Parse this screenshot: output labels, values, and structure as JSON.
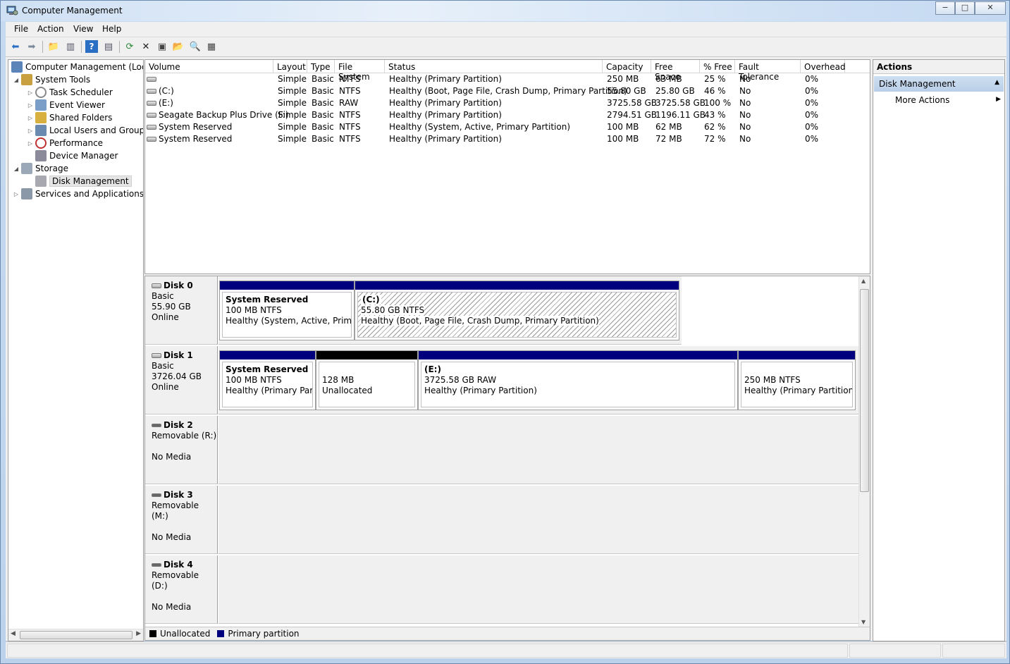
{
  "window": {
    "title": "Computer Management",
    "min": "−",
    "max": "□",
    "close": "✕"
  },
  "menu": [
    "File",
    "Action",
    "View",
    "Help"
  ],
  "tree": {
    "root": "Computer Management (Local",
    "system_tools": "System Tools",
    "task_scheduler": "Task Scheduler",
    "event_viewer": "Event Viewer",
    "shared_folders": "Shared Folders",
    "local_users": "Local Users and Groups",
    "performance": "Performance",
    "device_manager": "Device Manager",
    "storage": "Storage",
    "disk_management": "Disk Management",
    "services": "Services and Applications"
  },
  "volumes": {
    "headers": [
      "Volume",
      "Layout",
      "Type",
      "File System",
      "Status",
      "Capacity",
      "Free Space",
      "% Free",
      "Fault Tolerance",
      "Overhead"
    ],
    "rows": [
      [
        "",
        "Simple",
        "Basic",
        "NTFS",
        "Healthy (Primary Partition)",
        "250 MB",
        "63 MB",
        "25 %",
        "No",
        "0%"
      ],
      [
        "(C:)",
        "Simple",
        "Basic",
        "NTFS",
        "Healthy (Boot, Page File, Crash Dump, Primary Partition)",
        "55.80 GB",
        "25.80 GB",
        "46 %",
        "No",
        "0%"
      ],
      [
        "(E:)",
        "Simple",
        "Basic",
        "RAW",
        "Healthy (Primary Partition)",
        "3725.58 GB",
        "3725.58 GB",
        "100 %",
        "No",
        "0%"
      ],
      [
        "Seagate Backup Plus Drive (F:)",
        "Simple",
        "Basic",
        "NTFS",
        "Healthy (Primary Partition)",
        "2794.51 GB",
        "1196.11 GB",
        "43 %",
        "No",
        "0%"
      ],
      [
        "System Reserved",
        "Simple",
        "Basic",
        "NTFS",
        "Healthy (System, Active, Primary Partition)",
        "100 MB",
        "62 MB",
        "62 %",
        "No",
        "0%"
      ],
      [
        "System Reserved",
        "Simple",
        "Basic",
        "NTFS",
        "Healthy (Primary Partition)",
        "100 MB",
        "72 MB",
        "72 %",
        "No",
        "0%"
      ]
    ]
  },
  "disks": [
    {
      "name": "Disk 0",
      "type": "Basic",
      "size": "55.90 GB",
      "state": "Online",
      "partitions": [
        {
          "title": "System Reserved",
          "size": "100 MB NTFS",
          "status": "Healthy (System, Active, Primary P"
        },
        {
          "title": "(C:)",
          "size": "55.80 GB NTFS",
          "status": "Healthy (Boot, Page File, Crash Dump, Primary Partition)"
        }
      ]
    },
    {
      "name": "Disk 1",
      "type": "Basic",
      "size": "3726.04 GB",
      "state": "Online",
      "partitions": [
        {
          "title": "System Reserved",
          "size": "100 MB NTFS",
          "status": "Healthy (Primary Partition)"
        },
        {
          "title": "",
          "size": "128 MB",
          "status": "Unallocated"
        },
        {
          "title": "(E:)",
          "size": "3725.58 GB RAW",
          "status": "Healthy (Primary Partition)"
        },
        {
          "title": "",
          "size": "250 MB NTFS",
          "status": "Healthy (Primary Partition)"
        }
      ]
    },
    {
      "name": "Disk 2",
      "type": "Removable (R:)",
      "state": "No Media"
    },
    {
      "name": "Disk 3",
      "type": "Removable (M:)",
      "state": "No Media"
    },
    {
      "name": "Disk 4",
      "type": "Removable (D:)",
      "state": "No Media"
    }
  ],
  "legend": {
    "unallocated": "Unallocated",
    "primary": "Primary partition"
  },
  "actions": {
    "title": "Actions",
    "section": "Disk Management",
    "more": "More Actions"
  },
  "colors": {
    "primary_partition": "#00007f",
    "unallocated": "#000000",
    "selection": "#cfdff1"
  }
}
